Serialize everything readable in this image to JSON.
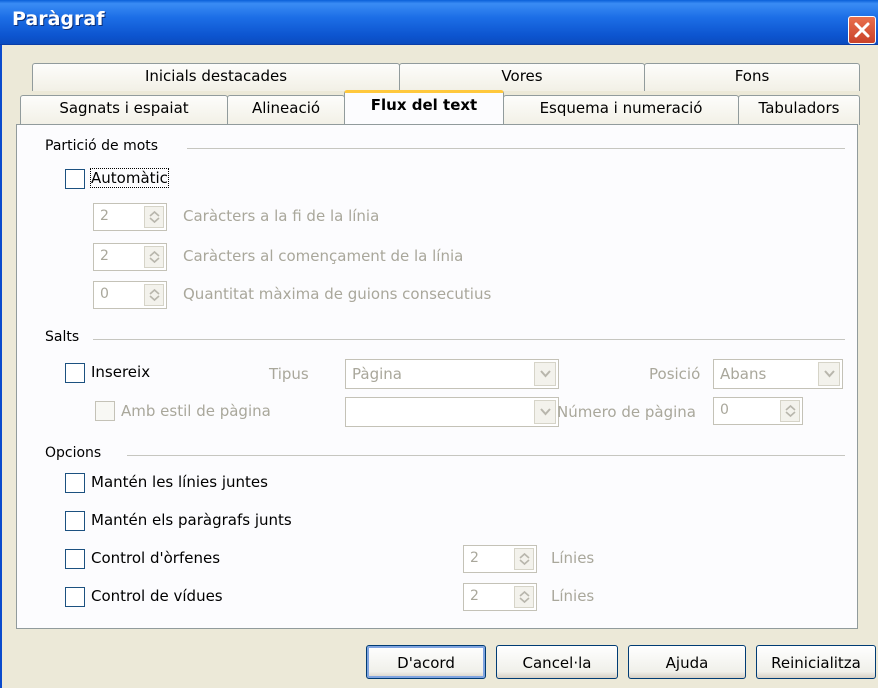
{
  "window": {
    "title": "Paràgraf",
    "close_icon": "close-icon"
  },
  "tabs_row1": [
    {
      "label": "Inicials destacades"
    },
    {
      "label": "Vores"
    },
    {
      "label": "Fons"
    }
  ],
  "tabs_row2": [
    {
      "label": "Sagnats i espaiat"
    },
    {
      "label": "Alineació"
    },
    {
      "label": "Flux del text",
      "active": true
    },
    {
      "label": "Esquema i numeració"
    },
    {
      "label": "Tabuladors"
    }
  ],
  "hyphenation": {
    "section_title": "Partició de mots",
    "automatic": {
      "label": "Automàtic",
      "checked": false
    },
    "chars_end": {
      "value": "2",
      "label": "Caràcters a la fi de la línia"
    },
    "chars_start": {
      "value": "2",
      "label": "Caràcters al començament de la línia"
    },
    "max_hyphens": {
      "value": "0",
      "label": "Quantitat màxima de guions consecutius"
    }
  },
  "breaks": {
    "section_title": "Salts",
    "insert": {
      "label": "Insereix",
      "checked": false
    },
    "type_label": "Tipus",
    "type_value": "Pàgina",
    "position_label": "Posició",
    "position_value": "Abans",
    "page_style": {
      "label": "Amb estil de pàgina",
      "checked": false
    },
    "page_style_value": "",
    "page_number_label": "Número de pàgina",
    "page_number_value": "0"
  },
  "options": {
    "section_title": "Opcions",
    "keep_lines": {
      "label": "Mantén les línies juntes",
      "checked": false
    },
    "keep_paragraphs": {
      "label": "Mantén els paràgrafs junts",
      "checked": false
    },
    "orphans": {
      "label": "Control d'òrfenes",
      "checked": false,
      "value": "2",
      "unit": "Línies"
    },
    "widows": {
      "label": "Control de vídues",
      "checked": false,
      "value": "2",
      "unit": "Línies"
    }
  },
  "buttons": {
    "ok": "D'acord",
    "cancel": "Cancel·la",
    "help": "Ajuda",
    "reset": "Reinicialitza"
  }
}
